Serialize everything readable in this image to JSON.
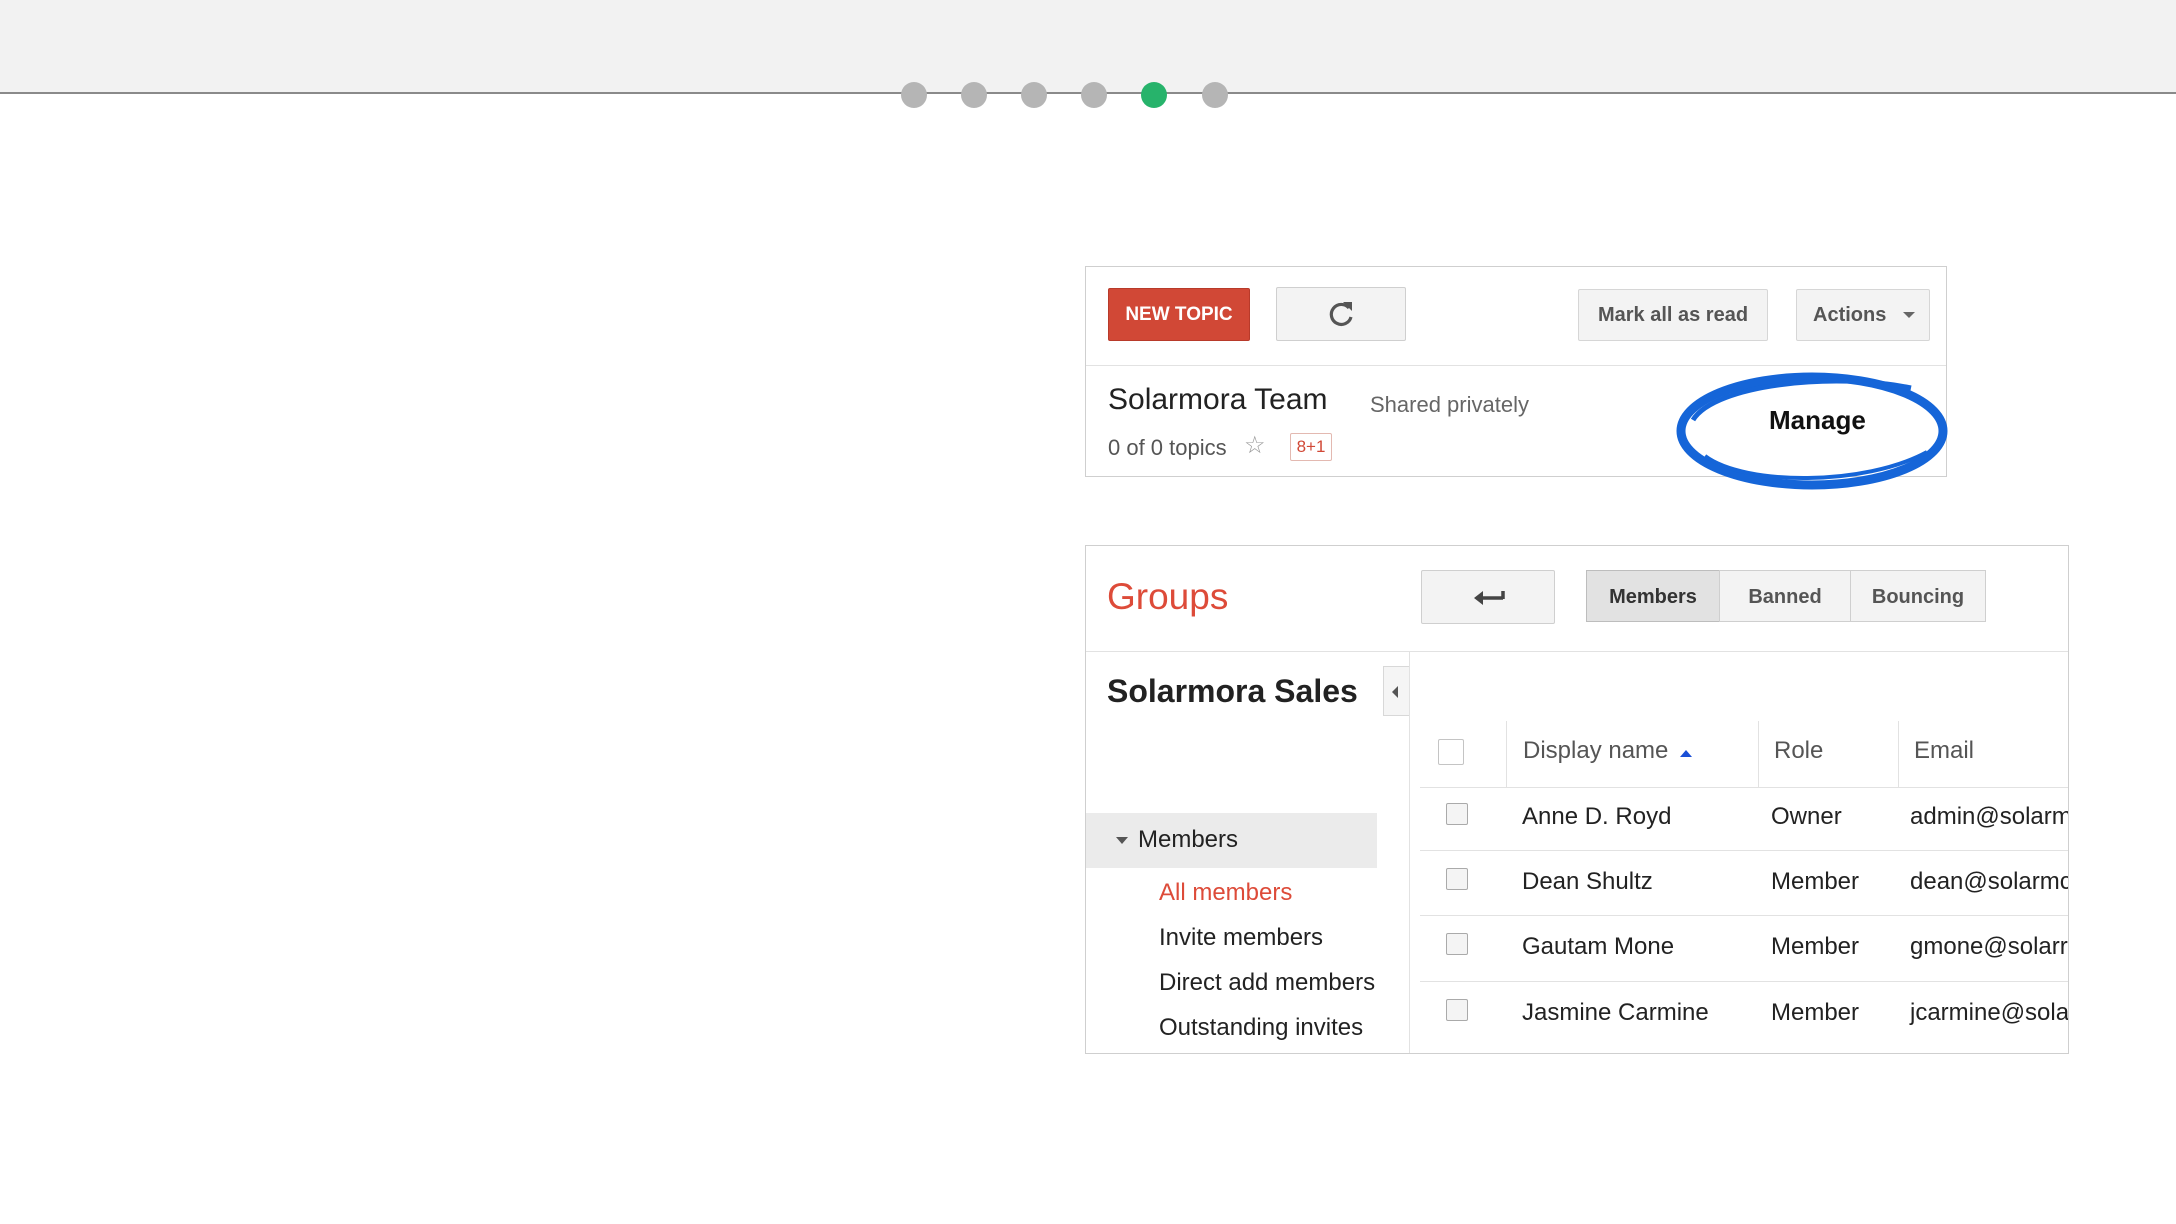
{
  "pager": {
    "total": 6,
    "active_index": 4
  },
  "colors": {
    "active_dot": "#27b36b",
    "inactive_dot": "#b5b5b5",
    "new_topic": "#d14836",
    "groups_title": "#dd4b39",
    "manage_circle": "#1565d8",
    "sort_arrow": "#1a4fd6"
  },
  "forum": {
    "toolbar": {
      "new_topic_label": "NEW TOPIC",
      "refresh_icon": "refresh-icon",
      "mark_all_read_label": "Mark all as read",
      "actions_label": "Actions"
    },
    "group_name": "Solarmora Team",
    "sharing": "Shared privately",
    "topics_count": "0 of 0 topics",
    "plus_one_label": "8+1",
    "manage_label": "Manage"
  },
  "admin": {
    "title": "Groups",
    "back_icon": "back-arrow-icon",
    "tabs": [
      "Members",
      "Banned",
      "Bouncing"
    ],
    "selected_tab": "Members",
    "group_name": "Solarmora Sales",
    "nav": {
      "section": "Members",
      "items": [
        "All members",
        "Invite members",
        "Direct add members",
        "Outstanding invites"
      ],
      "active_item": "All members"
    },
    "table": {
      "headers": [
        "Display name",
        "Role",
        "Email"
      ],
      "sort_column": "Display name",
      "rows": [
        {
          "name": "Anne D. Royd",
          "role": "Owner",
          "email": "admin@solarm"
        },
        {
          "name": "Dean Shultz",
          "role": "Member",
          "email": "dean@solarmc"
        },
        {
          "name": "Gautam Mone",
          "role": "Member",
          "email": "gmone@solarr"
        },
        {
          "name": "Jasmine Carmine",
          "role": "Member",
          "email": "jcarmine@sola"
        }
      ]
    }
  }
}
